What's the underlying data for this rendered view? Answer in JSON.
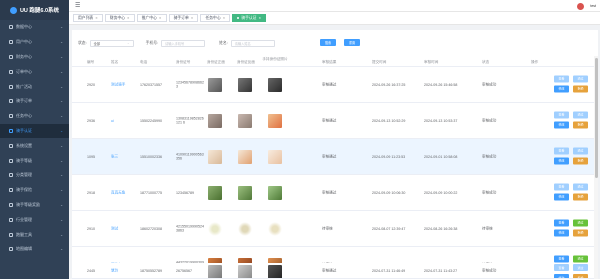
{
  "app": {
    "title": "UU 跑腿6.0系统"
  },
  "sidebar": {
    "items": [
      {
        "label": "数据中心",
        "icon": "dashboard-icon"
      },
      {
        "label": "用户中心",
        "icon": "user-icon"
      },
      {
        "label": "财务中心",
        "icon": "finance-icon"
      },
      {
        "label": "订单中心",
        "icon": "order-icon"
      },
      {
        "label": "推广活动",
        "icon": "promotion-icon"
      },
      {
        "label": "骑手订单",
        "icon": "rider-order-icon"
      },
      {
        "label": "任务中心",
        "icon": "task-icon"
      },
      {
        "label": "骑手认证",
        "icon": "rider-auth-icon"
      },
      {
        "label": "系统设置",
        "icon": "settings-icon"
      },
      {
        "label": "骑手等级",
        "icon": "level-icon"
      },
      {
        "label": "分类管理",
        "icon": "category-icon"
      },
      {
        "label": "骑手保险",
        "icon": "insurance-icon"
      },
      {
        "label": "骑手等级奖励",
        "icon": "reward-icon"
      },
      {
        "label": "行业管理",
        "icon": "industry-icon"
      },
      {
        "label": "跑腿工具",
        "icon": "tool-icon"
      },
      {
        "label": "地图编辑",
        "icon": "map-icon"
      }
    ]
  },
  "topbar": {
    "username": "test"
  },
  "tabs": [
    {
      "label": "用户列表"
    },
    {
      "label": "财务中心"
    },
    {
      "label": "推广中心"
    },
    {
      "label": "骑手订单"
    },
    {
      "label": "任务中心"
    },
    {
      "label": "骑手认证",
      "active": true
    }
  ],
  "filters": {
    "status_label": "状态:",
    "status_value": "全部",
    "phone_label": "手机号:",
    "phone_placeholder": "请输入手机号",
    "name_label": "姓名:",
    "name_placeholder": "请输入姓名",
    "search_label": "搜索",
    "reset_label": "重置"
  },
  "table": {
    "headers": {
      "id": "编号",
      "name": "姓名",
      "phone": "电话",
      "idcard": "身份证号",
      "front": "身份证正面",
      "back": "身份证反面",
      "hand": "手持身份证照片",
      "status": "审核结果",
      "submit_time": "提交时间",
      "audit_time": "审核时间",
      "state": "状态",
      "ops": "操作"
    },
    "rows": [
      {
        "id": "2920",
        "name": "测试骑手",
        "phone": "17620371557",
        "idcard": "123456789086623",
        "status": "审核通过",
        "submit_time": "2024-09-26 16:37:25",
        "audit_time": "2024-09-26 15:46:58",
        "state": "审核成功",
        "ops": [
          "查看",
          "通过",
          "修改",
          "拒绝"
        ]
      },
      {
        "id": "2936",
        "name": "ui",
        "phone": "15502245990",
        "idcard": "13083119852826121 6",
        "status": "审核通过",
        "submit_time": "2024-09-13 10:52:29",
        "audit_time": "2024-09-13 10:53:37",
        "state": "审核成功",
        "ops": [
          "查看",
          "通过",
          "修改",
          "拒绝"
        ]
      },
      {
        "id": "1095",
        "name": "张三",
        "phone": "15510002336",
        "idcard": "41090119900563356",
        "status": "审核通过",
        "submit_time": "2024-09-09 11:23:53",
        "audit_time": "2024-09-01 10:58:08",
        "state": "审核成功",
        "ops": [
          "查看",
          "通过",
          "修改",
          "拒绝"
        ]
      },
      {
        "id": "2918",
        "name": "真真无鱼",
        "phone": "18771000775",
        "idcard": "123456789",
        "status": "审核通过",
        "submit_time": "2024-09-09 10:06:30",
        "audit_time": "2024-09-09 10:00:22",
        "state": "审核成功",
        "ops": [
          "查看",
          "通过",
          "修改",
          "拒绝"
        ]
      },
      {
        "id": "2910",
        "name": "测试",
        "phone": "18602720308",
        "idcard": "421550199905243863",
        "status": "待审核",
        "submit_time": "2024-08-07 12:39:47",
        "audit_time": "2024-08-26 16:26:38",
        "state": "待审核",
        "ops": [
          "查看",
          "通过",
          "修改",
          "拒绝"
        ]
      },
      {
        "id": "2446",
        "name": "可怜心",
        "phone": "15552808222",
        "idcard": "44322019900309009 6",
        "status": "待审核",
        "submit_time": "2024-07-31 14:37:42",
        "audit_time": "2024-06-13 15:00:36",
        "state": "待审核",
        "ops": [
          "查看",
          "通过",
          "修改",
          "拒绝"
        ]
      },
      {
        "id": "2445",
        "name": "慧玲",
        "phone": "18750552789",
        "idcard": "26756567",
        "status": "审核通过",
        "submit_time": "2024-07-31 11:46:49",
        "audit_time": "2024-07-31 11:43:27",
        "state": "审核成功",
        "ops": [
          "查看",
          "通过",
          "修改",
          "拒绝"
        ]
      }
    ]
  }
}
